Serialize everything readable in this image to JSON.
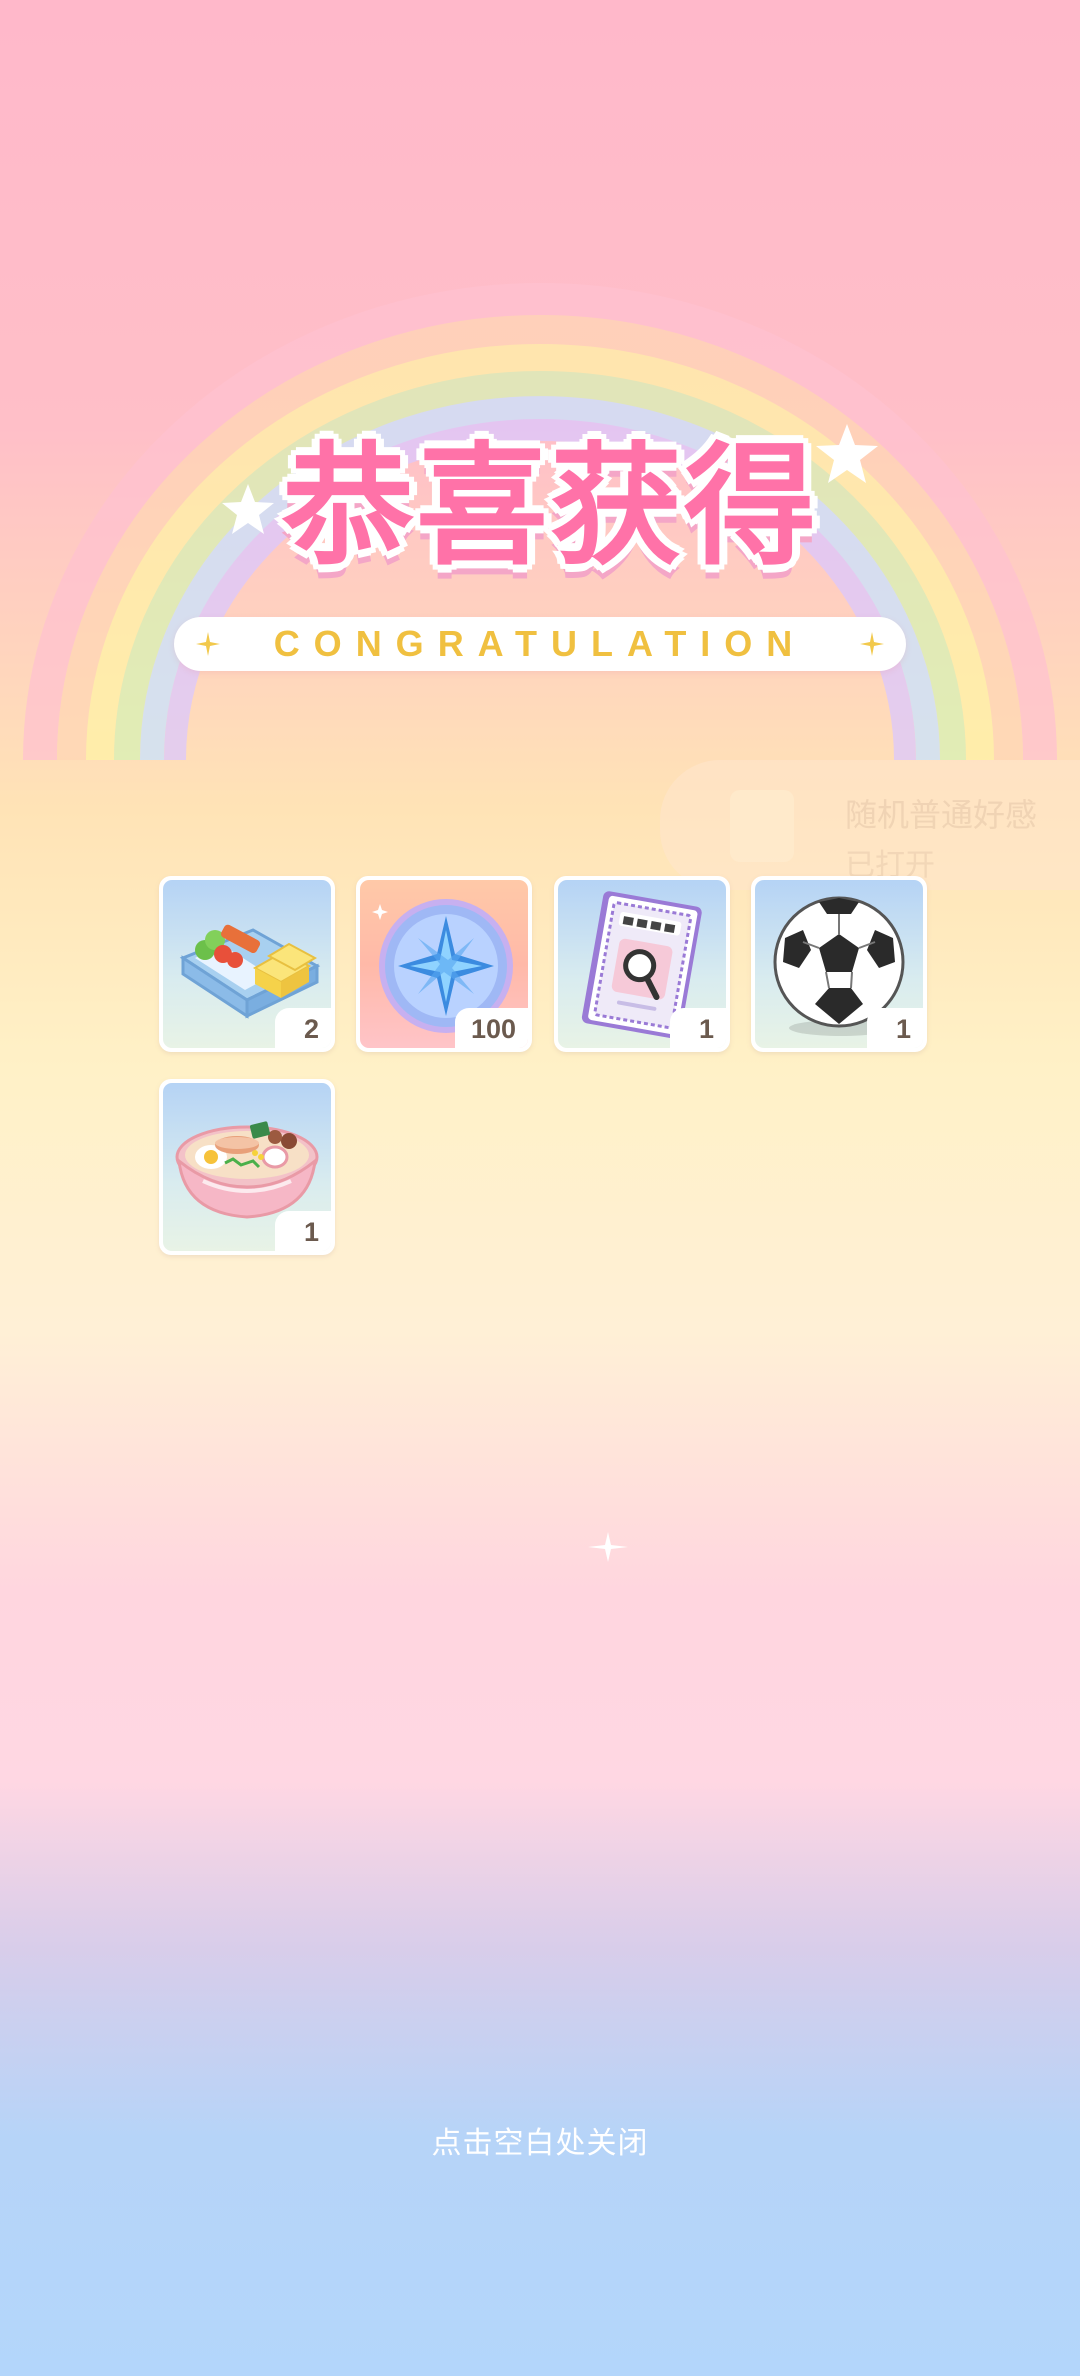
{
  "title": {
    "main": "恭喜获得",
    "subtitle": "CONGRATULATION"
  },
  "background_toast": {
    "text": "随机普通好感",
    "sub": "已打开"
  },
  "rewards": [
    {
      "name": "bento-box",
      "quantity": "2",
      "background": "blue"
    },
    {
      "name": "star-coin",
      "quantity": "100",
      "background": "orange"
    },
    {
      "name": "magic-book",
      "quantity": "1",
      "background": "blue"
    },
    {
      "name": "soccer-ball",
      "quantity": "1",
      "background": "blue"
    },
    {
      "name": "ramen-bowl",
      "quantity": "1",
      "background": "blue"
    }
  ],
  "close_hint": "点击空白处关闭",
  "colors": {
    "title_pink": "#ff72a8",
    "subtitle_gold": "#f0c040",
    "qty_text": "#6b5a4e"
  }
}
